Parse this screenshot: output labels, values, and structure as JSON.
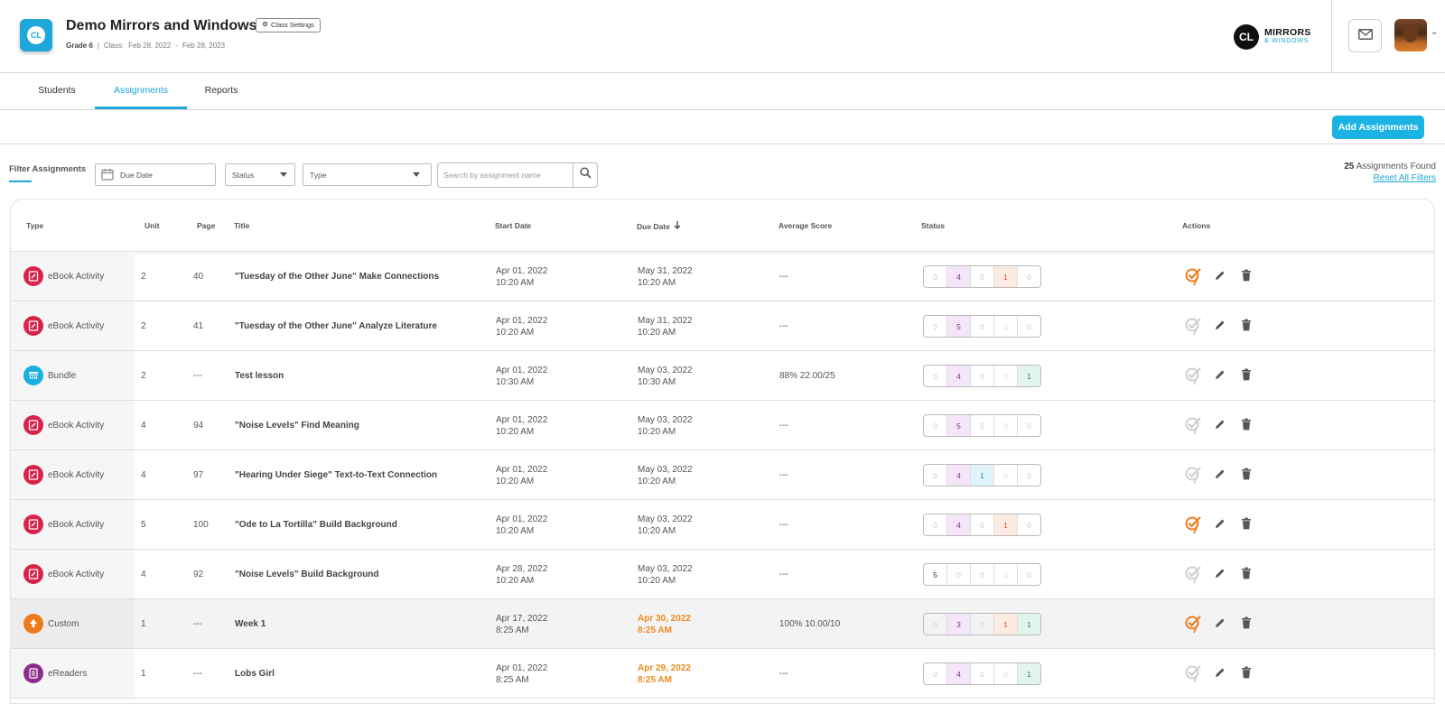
{
  "header": {
    "class_title": "Demo Mirrors and Windows",
    "class_settings_label": "Class Settings",
    "grade": "Grade 6",
    "class_label": "Class:",
    "class_start": "Feb 28, 2022",
    "class_sep": "-",
    "class_end": "Feb 28, 2023",
    "app_logo_text": "CL",
    "brand_line1": "MIRRORS",
    "brand_line2": "& WINDOWS"
  },
  "tabs": [
    {
      "label": "Students",
      "active": false
    },
    {
      "label": "Assignments",
      "active": true
    },
    {
      "label": "Reports",
      "active": false
    }
  ],
  "toolbar": {
    "add_assignments_label": "Add Assignments"
  },
  "filters": {
    "label": "Filter Assignments",
    "due_date_placeholder": "Due Date",
    "status_label": "Status",
    "type_label": "Type",
    "search_placeholder": "Search by assignment name",
    "found_count": "25",
    "found_text": "Assignments Found",
    "reset_label": "Reset All Filters"
  },
  "table": {
    "headers": {
      "type": "Type",
      "unit": "Unit",
      "page": "Page",
      "title": "Title",
      "start": "Start Date",
      "due": "Due Date",
      "avg": "Average Score",
      "status": "Status",
      "actions": "Actions"
    },
    "rows": [
      {
        "type": "eBook Activity",
        "kind": "ebook",
        "unit": "2",
        "page": "40",
        "title": "\"Tuesday of the Other June\" Make Connections",
        "start_date": "Apr 01, 2022",
        "start_time": "10:20 AM",
        "due_date": "May 31, 2022",
        "due_time": "10:20 AM",
        "late": false,
        "avg": "---",
        "status": [
          "0",
          "4",
          "0",
          "1",
          "0"
        ],
        "grade_active": true
      },
      {
        "type": "eBook Activity",
        "kind": "ebook",
        "unit": "2",
        "page": "41",
        "title": "\"Tuesday of the Other June\" Analyze Literature",
        "start_date": "Apr 01, 2022",
        "start_time": "10:20 AM",
        "due_date": "May 31, 2022",
        "due_time": "10:20 AM",
        "late": false,
        "avg": "---",
        "status": [
          "0",
          "5",
          "0",
          "0",
          "0"
        ],
        "grade_active": false
      },
      {
        "type": "Bundle",
        "kind": "bundle",
        "unit": "2",
        "page": "---",
        "title": "Test lesson",
        "start_date": "Apr 01, 2022",
        "start_time": "10:30 AM",
        "due_date": "May 03, 2022",
        "due_time": "10:30 AM",
        "late": false,
        "avg": "88% 22.00/25",
        "status": [
          "0",
          "4",
          "0",
          "0",
          "1"
        ],
        "grade_active": false
      },
      {
        "type": "eBook Activity",
        "kind": "ebook",
        "unit": "4",
        "page": "94",
        "title": "\"Noise Levels\" Find Meaning",
        "start_date": "Apr 01, 2022",
        "start_time": "10:20 AM",
        "due_date": "May 03, 2022",
        "due_time": "10:20 AM",
        "late": false,
        "avg": "---",
        "status": [
          "0",
          "5",
          "0",
          "0",
          "0"
        ],
        "grade_active": false
      },
      {
        "type": "eBook Activity",
        "kind": "ebook",
        "unit": "4",
        "page": "97",
        "title": "\"Hearing Under Siege\" Text-to-Text Connection",
        "start_date": "Apr 01, 2022",
        "start_time": "10:20 AM",
        "due_date": "May 03, 2022",
        "due_time": "10:20 AM",
        "late": false,
        "avg": "---",
        "status": [
          "0",
          "4",
          "1",
          "0",
          "0"
        ],
        "grade_active": false
      },
      {
        "type": "eBook Activity",
        "kind": "ebook",
        "unit": "5",
        "page": "100",
        "title": "\"Ode to La Tortilla\" Build Background",
        "start_date": "Apr 01, 2022",
        "start_time": "10:20 AM",
        "due_date": "May 03, 2022",
        "due_time": "10:20 AM",
        "late": false,
        "avg": "---",
        "status": [
          "0",
          "4",
          "0",
          "1",
          "0"
        ],
        "grade_active": true
      },
      {
        "type": "eBook Activity",
        "kind": "ebook",
        "unit": "4",
        "page": "92",
        "title": "\"Noise Levels\" Build Background",
        "start_date": "Apr 28, 2022",
        "start_time": "10:20 AM",
        "due_date": "May 03, 2022",
        "due_time": "10:20 AM",
        "late": false,
        "avg": "---",
        "status": [
          "5",
          "0",
          "0",
          "0",
          "0"
        ],
        "grade_active": false
      },
      {
        "type": "Custom",
        "kind": "custom",
        "unit": "1",
        "page": "---",
        "title": "Week 1",
        "start_date": "Apr 17, 2022",
        "start_time": "8:25 AM",
        "due_date": "Apr 30, 2022",
        "due_time": "8:25 AM",
        "late": true,
        "avg": "100% 10.00/10",
        "status": [
          "0",
          "3",
          "0",
          "1",
          "1"
        ],
        "grade_active": true,
        "highlight": true
      },
      {
        "type": "eReaders",
        "kind": "ereader",
        "unit": "1",
        "page": "---",
        "title": "Lobs Girl",
        "start_date": "Apr 01, 2022",
        "start_time": "8:25 AM",
        "due_date": "Apr 29, 2022",
        "due_time": "8:25 AM",
        "late": true,
        "avg": "---",
        "status": [
          "0",
          "4",
          "0",
          "0",
          "1"
        ],
        "grade_active": false
      }
    ]
  },
  "colors": {
    "accent": "#1ea7d9",
    "button": "#1bb3e3",
    "late_due": "#ee8a1f",
    "ebook": "#d8234b",
    "bundle": "#1ab0e2",
    "custom": "#ec7b1c",
    "ereader": "#8d2d8b",
    "grade_active": "#ef7d1e",
    "grade_inactive": "#cfcfcf"
  },
  "icons": {
    "class_settings": "gear-icon",
    "due_date": "calendar-icon",
    "search": "search-icon",
    "mail": "envelope-icon",
    "sort": "arrow-down-icon",
    "grade": "check-grade-icon",
    "edit": "pencil-icon",
    "delete": "trash-icon"
  }
}
